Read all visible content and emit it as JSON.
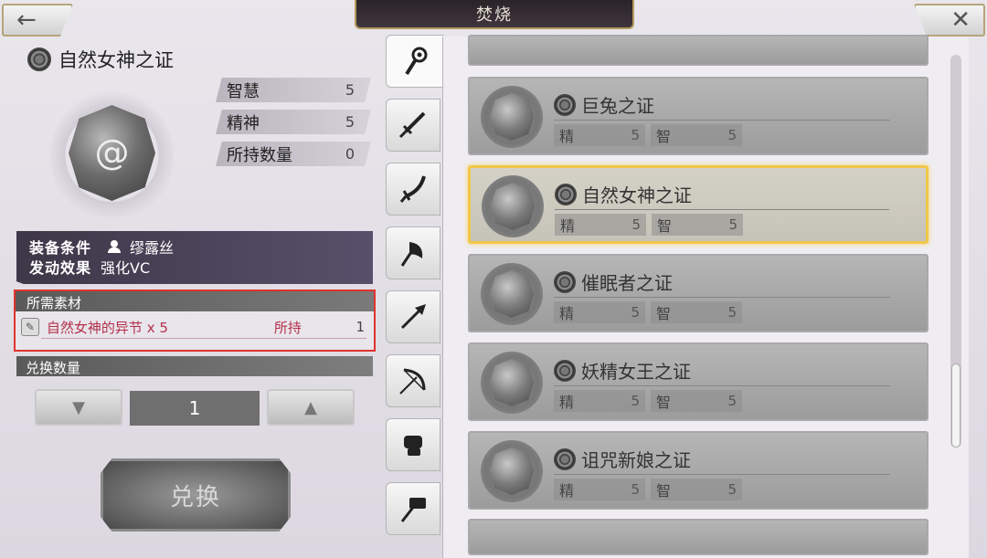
{
  "screen_title": "焚烧",
  "icons": {
    "back": "←",
    "close": "✕",
    "down": "▼",
    "up": "▲",
    "note": "✎"
  },
  "selected_item": {
    "name": "自然女神之证",
    "stats": [
      {
        "label": "智慧",
        "value": "5"
      },
      {
        "label": "精神",
        "value": "5"
      },
      {
        "label": "所持数量",
        "value": "0"
      }
    ],
    "equip_condition_label": "装备条件",
    "equip_condition_value": "缪露丝",
    "effect_label": "发动效果",
    "effect_value": "强化VC"
  },
  "materials": {
    "header": "所需素材",
    "item_name": "自然女神的异节 x 5",
    "own_label": "所持",
    "own_count": "1"
  },
  "exchange": {
    "label": "兑换数量",
    "quantity": "1",
    "button_label": "兑换"
  },
  "tabs": [
    {
      "name": "staff",
      "active": true
    },
    {
      "name": "sword",
      "active": false
    },
    {
      "name": "curved-sword",
      "active": false
    },
    {
      "name": "axe",
      "active": false
    },
    {
      "name": "spear",
      "active": false
    },
    {
      "name": "bow",
      "active": false
    },
    {
      "name": "gauntlet",
      "active": false
    },
    {
      "name": "hammer",
      "active": false
    }
  ],
  "list": [
    {
      "name": "巨兔之证",
      "s1_label": "精",
      "s1_value": "5",
      "s2_label": "智",
      "s2_value": "5",
      "selected": false
    },
    {
      "name": "自然女神之证",
      "s1_label": "精",
      "s1_value": "5",
      "s2_label": "智",
      "s2_value": "5",
      "selected": true
    },
    {
      "name": "催眠者之证",
      "s1_label": "精",
      "s1_value": "5",
      "s2_label": "智",
      "s2_value": "5",
      "selected": false
    },
    {
      "name": "妖精女王之证",
      "s1_label": "精",
      "s1_value": "5",
      "s2_label": "智",
      "s2_value": "5",
      "selected": false
    },
    {
      "name": "诅咒新娘之证",
      "s1_label": "精",
      "s1_value": "5",
      "s2_label": "智",
      "s2_value": "5",
      "selected": false
    }
  ],
  "colors": {
    "highlight_border": "#e0332b",
    "selected_border": "#f1c64a"
  }
}
